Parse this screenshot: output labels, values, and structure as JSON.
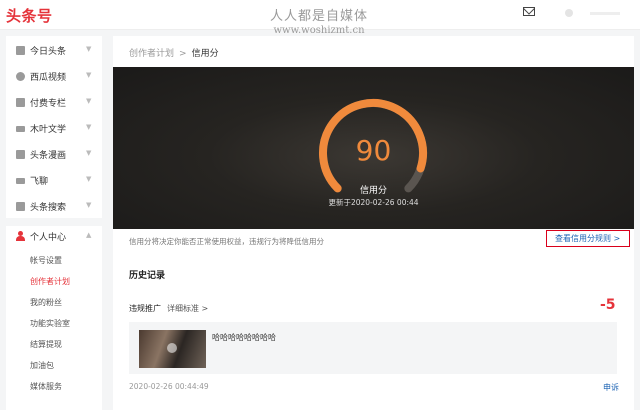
{
  "header": {
    "logo": "头条号",
    "watermark_title": "人人都是自媒体",
    "watermark_url": "www.woshizmt.cn",
    "mail_icon": "mail-icon",
    "avatar_icon": "avatar"
  },
  "sidebar": {
    "items": [
      {
        "label": "今日头条",
        "icon": "toutiao-icon"
      },
      {
        "label": "西瓜视频",
        "icon": "xigua-icon"
      },
      {
        "label": "付费专栏",
        "icon": "column-icon"
      },
      {
        "label": "木叶文学",
        "icon": "literature-icon"
      },
      {
        "label": "头条漫画",
        "icon": "comic-icon"
      },
      {
        "label": "飞聊",
        "icon": "feiliao-icon"
      },
      {
        "label": "头条搜索",
        "icon": "search-icon"
      }
    ],
    "personal_center": {
      "label": "个人中心",
      "icon": "person-icon",
      "sub_items": [
        {
          "label": "帐号设置",
          "active": false
        },
        {
          "label": "创作者计划",
          "active": true
        },
        {
          "label": "我的粉丝",
          "active": false
        },
        {
          "label": "功能实验室",
          "active": false
        },
        {
          "label": "结算提现",
          "active": false
        },
        {
          "label": "加油包",
          "active": false
        },
        {
          "label": "媒体服务",
          "active": false
        }
      ]
    },
    "arrow_glyph": "▼",
    "arrow_up_glyph": "▲"
  },
  "breadcrumb": {
    "parent": "创作者计划",
    "separator": ">",
    "current": "信用分"
  },
  "credit": {
    "score": "90",
    "score_value": 90,
    "score_max": 100,
    "label": "信用分",
    "updated": "更新于2020-02-26 00:44",
    "info": "信用分将决定你能否正常使用权益，违规行为将降低信用分",
    "rules_link": "查看信用分规则 >"
  },
  "history": {
    "title": "历史记录",
    "record": {
      "type": "违规推广",
      "detail_link": "详细标准 >",
      "penalty": "-5",
      "article_title": "哈哈哈哈哈哈哈哈",
      "time": "2020-02-26 00:44:49",
      "appeal": "申诉"
    }
  },
  "colors": {
    "brand_red": "#e5333a",
    "gauge_orange": "#f08a3c",
    "link_blue": "#1e64b4",
    "highlight_border": "#d9001b"
  }
}
